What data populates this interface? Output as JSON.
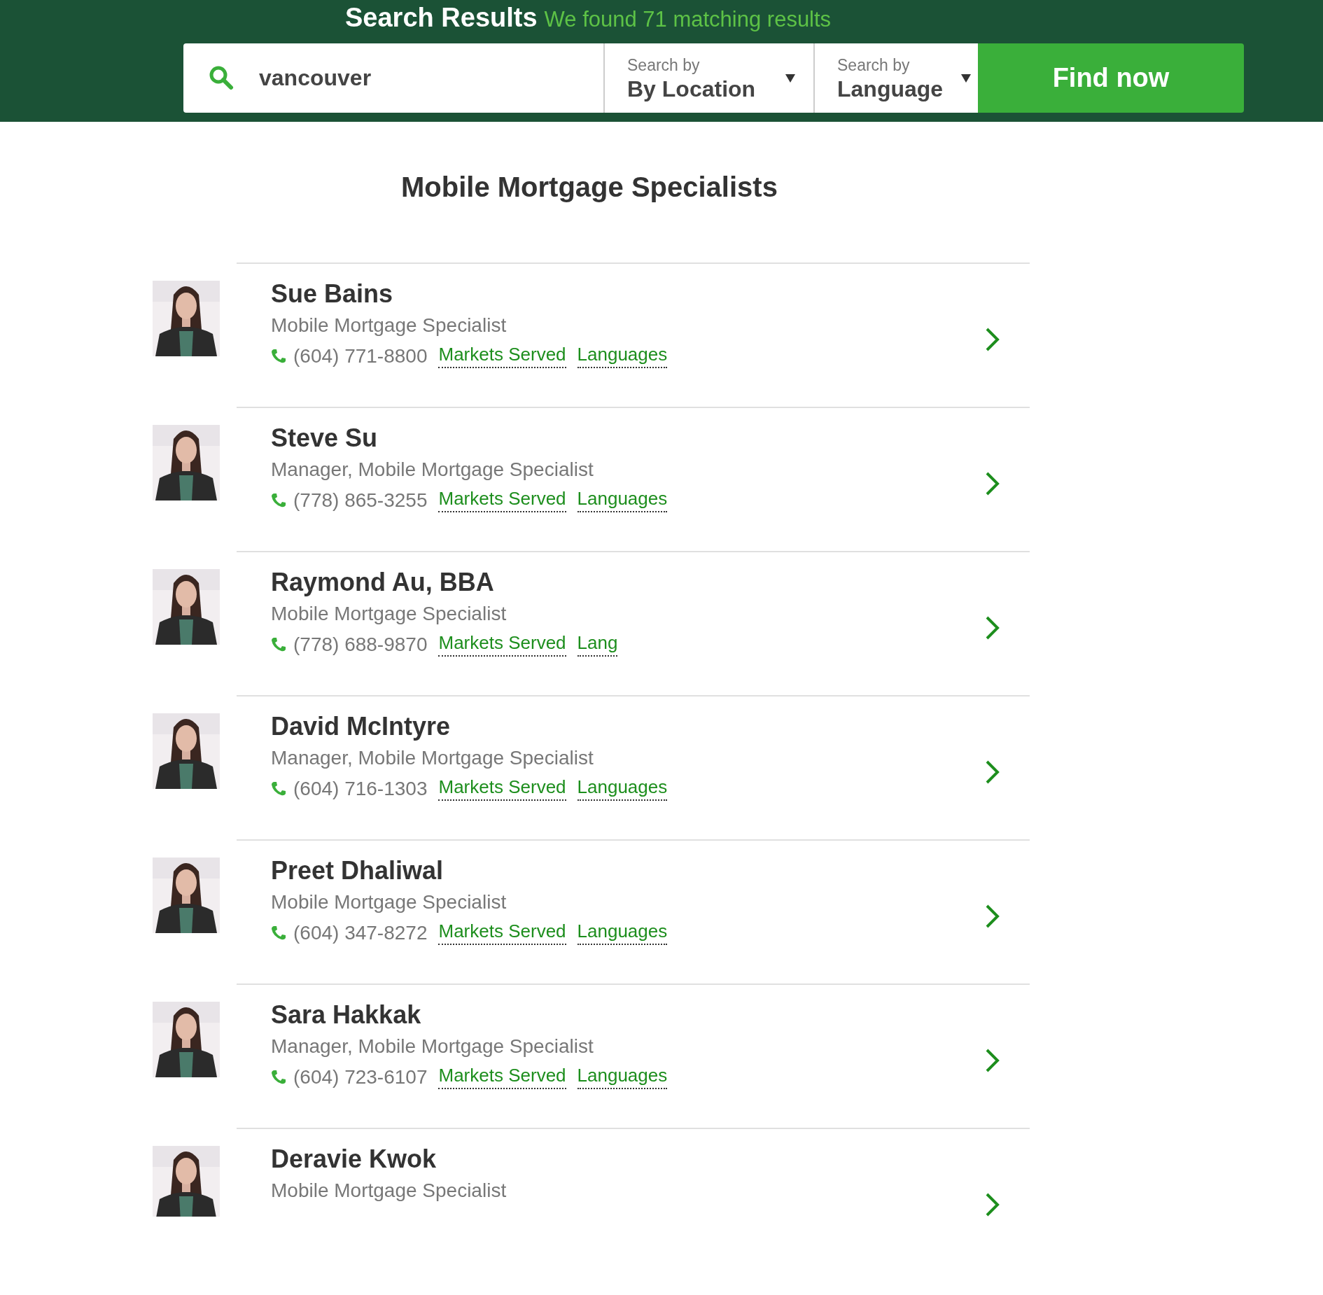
{
  "header": {
    "title": "Search Results",
    "subtitle": "We found 71 matching results"
  },
  "search": {
    "value": "vancouver",
    "dropdowns": [
      {
        "label": "Search by",
        "value": "By Location"
      },
      {
        "label": "Search by",
        "value": "Language"
      }
    ],
    "button": "Find now"
  },
  "heading": "Mobile Mortgage Specialists",
  "results": [
    {
      "name": "Sue Bains",
      "title": "Mobile Mortgage Specialist",
      "phone": "(604) 771-8800",
      "links": [
        "Markets Served",
        "Languages"
      ]
    },
    {
      "name": "Steve Su",
      "title": "Manager, Mobile Mortgage Specialist",
      "phone": "(778) 865-3255",
      "links": [
        "Markets Served",
        "Languages"
      ]
    },
    {
      "name": "Raymond Au, BBA",
      "title": "Mobile Mortgage Specialist",
      "phone": "(778) 688-9870",
      "links": [
        "Markets Served",
        "Lang"
      ]
    },
    {
      "name": "David McIntyre",
      "title": "Manager, Mobile Mortgage Specialist",
      "phone": "(604) 716-1303",
      "links": [
        "Markets Served",
        "Languages"
      ]
    },
    {
      "name": "Preet Dhaliwal",
      "title": "Mobile Mortgage Specialist",
      "phone": "(604) 347-8272",
      "links": [
        "Markets Served",
        "Languages"
      ]
    },
    {
      "name": "Sara Hakkak",
      "title": "Manager, Mobile Mortgage Specialist",
      "phone": "(604) 723-6107",
      "links": [
        "Markets Served",
        "Languages"
      ]
    },
    {
      "name": "Deravie Kwok",
      "title": "Mobile Mortgage Specialist"
    }
  ]
}
